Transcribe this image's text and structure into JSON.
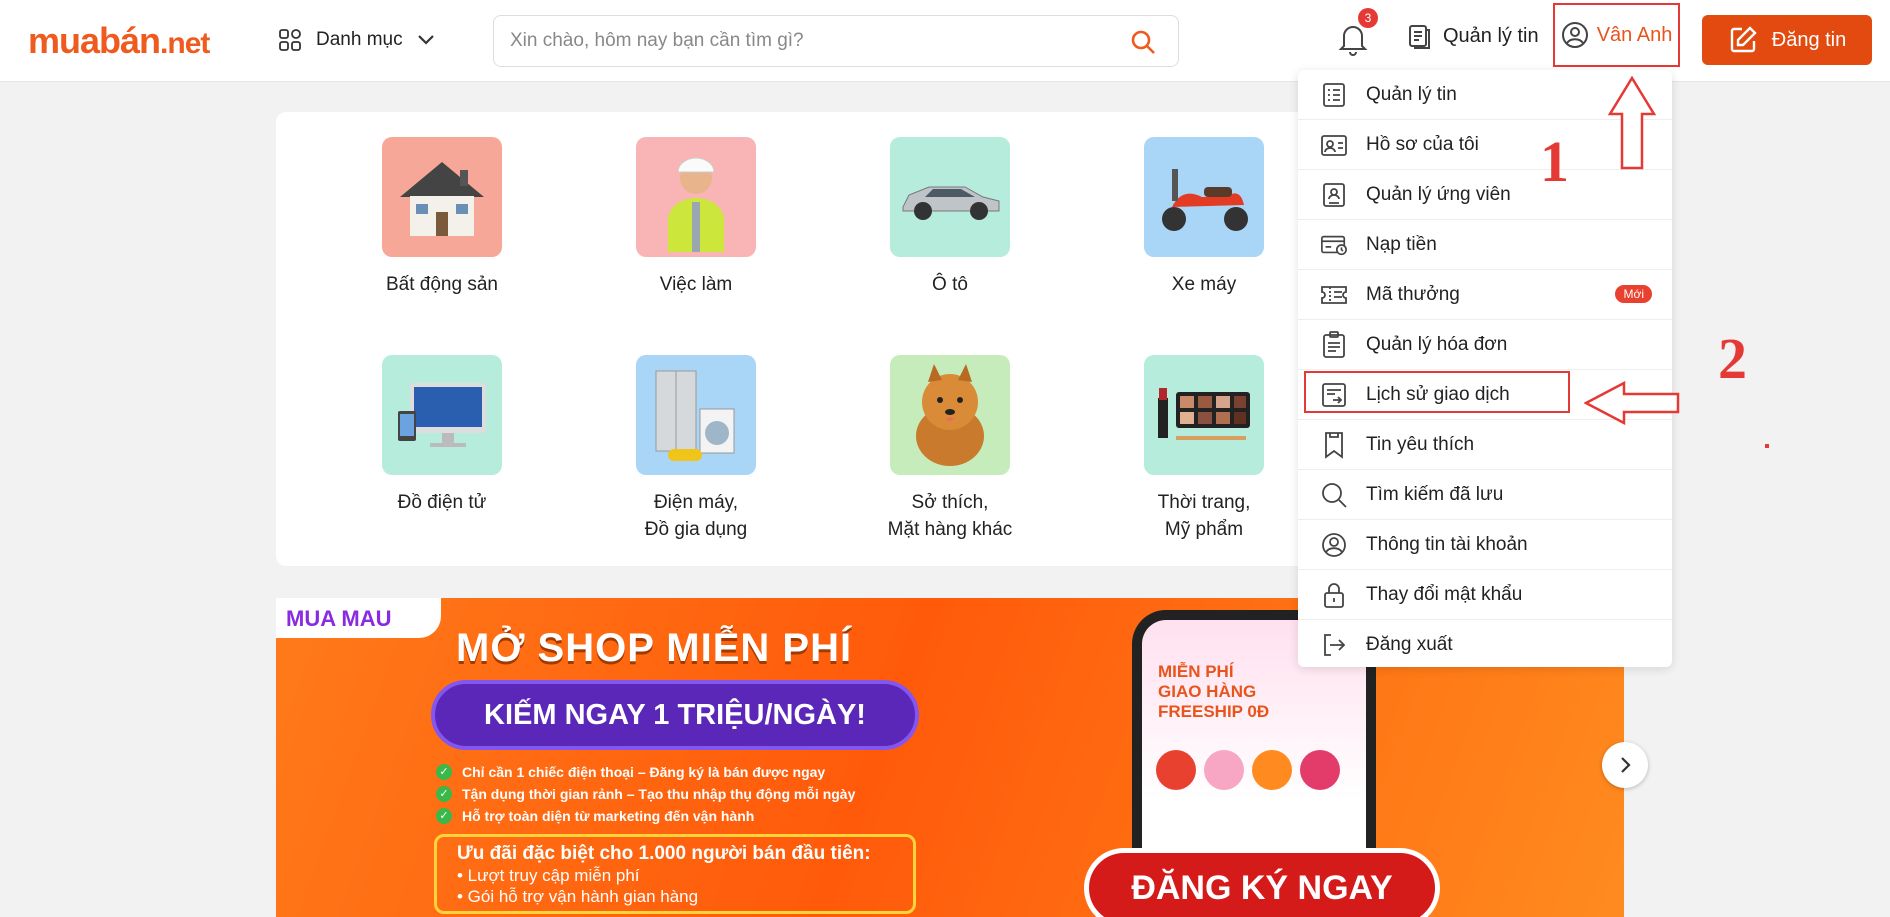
{
  "header": {
    "logo_main": "muabán",
    "logo_suffix": ".net",
    "category_label": "Danh mục",
    "search_placeholder": "Xin chào, hôm nay bạn cần tìm gì?",
    "notification_count": "3",
    "manage_label": "Quản lý tin",
    "user_name": "Vân Anh",
    "post_label": "Đăng tin"
  },
  "categories": [
    {
      "label": "Bất động sản",
      "bg": "#f7a797"
    },
    {
      "label": "Việc làm",
      "bg": "#f9b4b6"
    },
    {
      "label": "Ô tô",
      "bg": "#b6ecdc"
    },
    {
      "label": "Xe máy",
      "bg": "#a9d5f7"
    },
    {
      "label": "Đồ điện tử",
      "bg": "#b6ecdc"
    },
    {
      "label": "Điện máy,\nĐồ gia dụng",
      "bg": "#a9d5f7"
    },
    {
      "label": "Sở thích,\nMặt hàng khác",
      "bg": "#c7ecbc"
    },
    {
      "label": "Thời trang,\nMỹ phẩm",
      "bg": "#b6ecdc"
    }
  ],
  "banner": {
    "brand": "MUA MAU",
    "headline": "MỞ SHOP MIỄN PHÍ",
    "subheadline": "KIẾM NGAY 1 TRIỆU/NGÀY!",
    "bullets": [
      "Chỉ cần 1 chiếc điện thoại – Đăng ký là bán được ngay",
      "Tận dụng thời gian rảnh – Tạo thu nhập thụ động mỗi ngày",
      "Hỗ trợ toàn diện từ marketing đến vận hành"
    ],
    "offer_title": "Ưu đãi đặc biệt cho 1.000 người bán đầu tiên:",
    "offer_items": [
      "• Lượt truy cập miễn phí",
      "• Gói hỗ trợ vận hành gian hàng"
    ],
    "phone_promo_1": "MIỄN PHÍ",
    "phone_promo_2": "GIAO HÀNG",
    "phone_promo_3": "FREESHIP 0Đ",
    "cta": "ĐĂNG KÝ NGAY"
  },
  "menu": {
    "items": [
      {
        "label": "Quản lý tin",
        "icon": "list-icon"
      },
      {
        "label": "Hồ sơ của tôi",
        "icon": "profile-card-icon"
      },
      {
        "label": "Quản lý ứng viên",
        "icon": "candidate-icon"
      },
      {
        "label": "Nạp tiền",
        "icon": "wallet-icon"
      },
      {
        "label": "Mã thưởng",
        "icon": "voucher-icon",
        "badge": "Mới"
      },
      {
        "label": "Quản lý hóa đơn",
        "icon": "invoice-icon"
      },
      {
        "label": "Lịch sử giao dịch",
        "icon": "transaction-history-icon"
      },
      {
        "label": "Tin yêu thích",
        "icon": "bookmark-icon"
      },
      {
        "label": "Tìm kiếm đã lưu",
        "icon": "search-icon"
      },
      {
        "label": "Thông tin tài khoản",
        "icon": "account-icon"
      },
      {
        "label": "Thay đổi mật khẩu",
        "icon": "lock-icon"
      },
      {
        "label": "Đăng xuất",
        "icon": "logout-icon"
      }
    ]
  },
  "annotations": {
    "step1": "1",
    "step2": "2",
    "accent_color": "#e53935"
  },
  "colors": {
    "brand": "#ef5a1f",
    "post_button": "#e34a0f"
  }
}
